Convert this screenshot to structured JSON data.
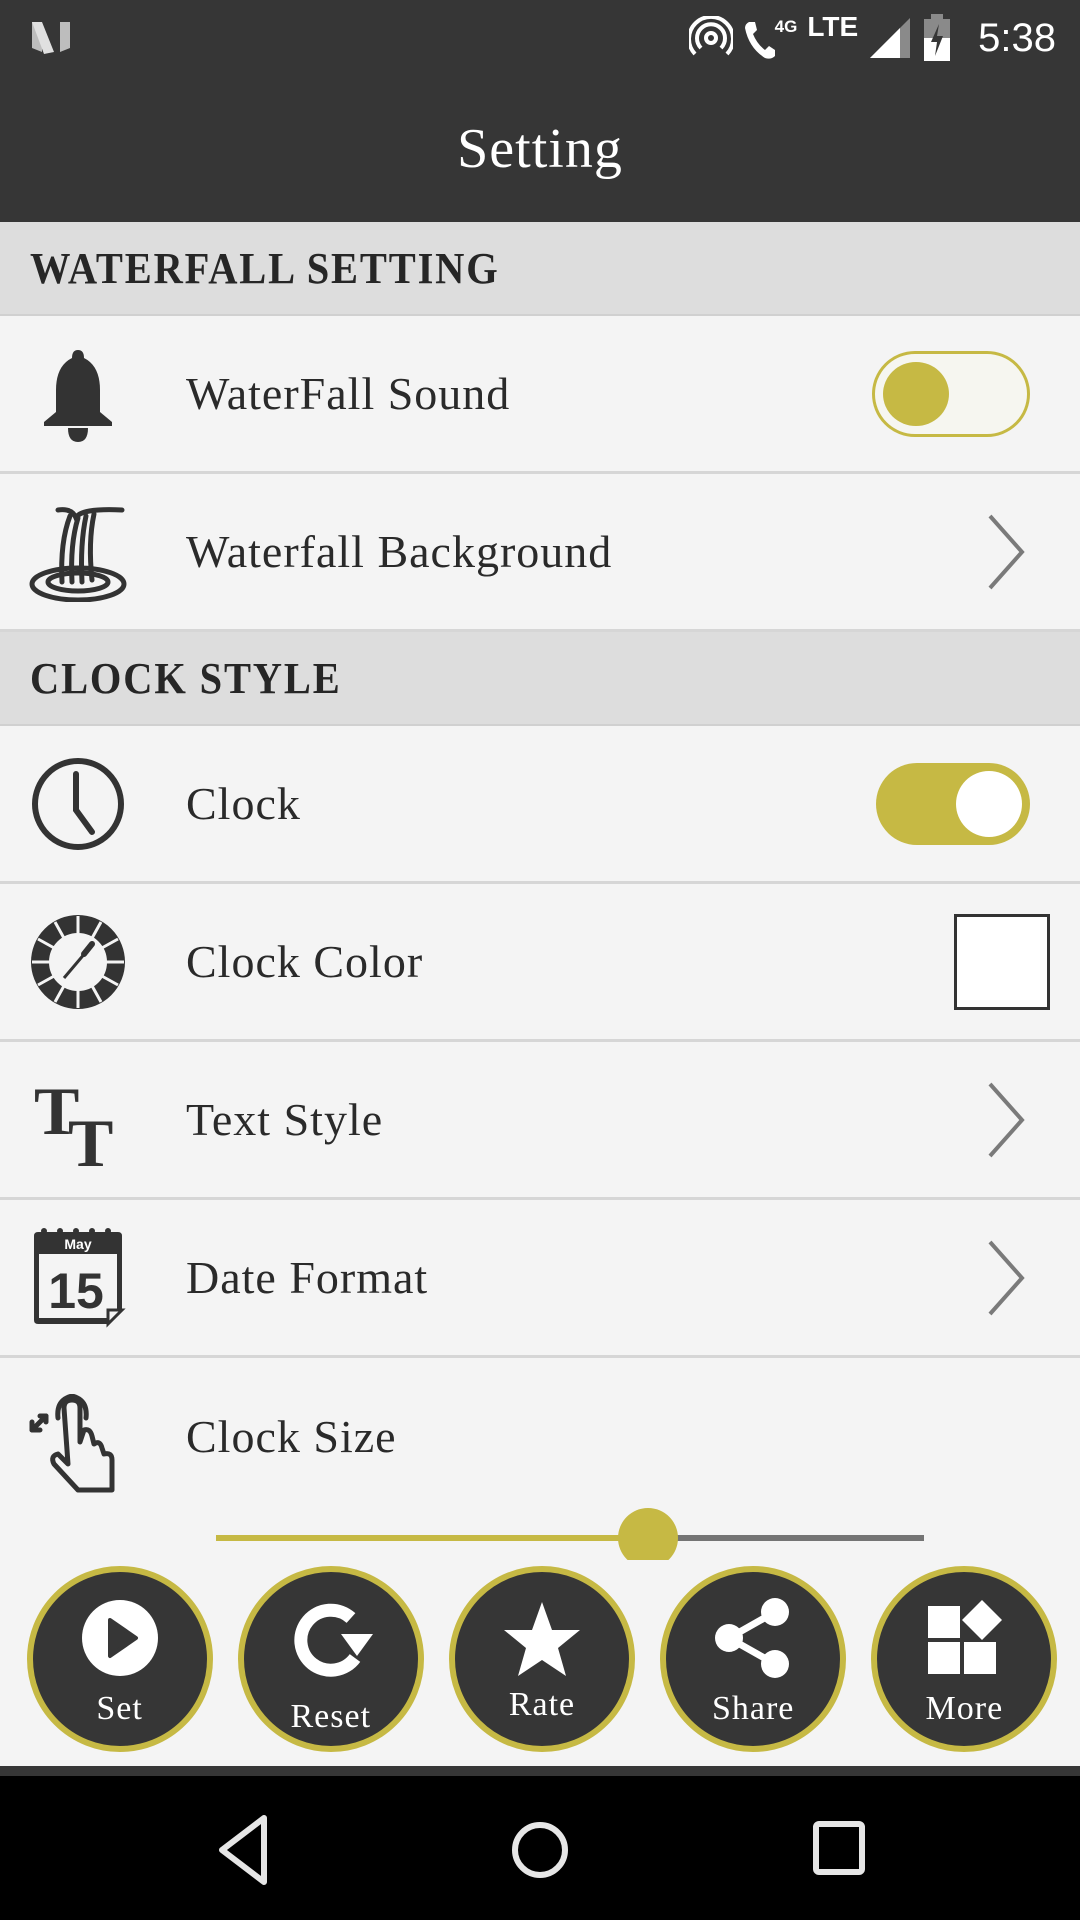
{
  "status_bar": {
    "time": "5:38",
    "network_label": "LTE",
    "call_badge": "4G",
    "icons": [
      "n-logo-icon",
      "hotspot-icon",
      "wifi-calling-icon",
      "signal-icon",
      "battery-charging-icon"
    ]
  },
  "app_bar": {
    "title": "Setting"
  },
  "sections": [
    {
      "header": "WATERFALL SETTING",
      "items": [
        {
          "label": "WaterFall Sound",
          "icon": "bell-icon",
          "control": "toggle",
          "enabled": false
        },
        {
          "label": "Waterfall Background",
          "icon": "waterfall-icon",
          "control": "chevron"
        }
      ]
    },
    {
      "header": "CLOCK STYLE",
      "items": [
        {
          "label": "Clock",
          "icon": "clock-icon",
          "control": "toggle",
          "enabled": true
        },
        {
          "label": "Clock Color",
          "icon": "color-picker-icon",
          "control": "swatch",
          "color": "#ffffff"
        },
        {
          "label": "Text Style",
          "icon": "text-style-icon",
          "control": "chevron"
        },
        {
          "label": "Date Format",
          "icon": "calendar-icon",
          "control": "chevron",
          "icon_text_month": "May",
          "icon_text_day": "15"
        },
        {
          "label": "Clock Size",
          "icon": "resize-gesture-icon",
          "control": "slider",
          "value_fraction": 0.61
        }
      ]
    }
  ],
  "actions": [
    {
      "label": "Set",
      "icon": "play-icon"
    },
    {
      "label": "Reset",
      "icon": "refresh-icon"
    },
    {
      "label": "Rate",
      "icon": "star-icon"
    },
    {
      "label": "Share",
      "icon": "share-icon"
    },
    {
      "label": "More",
      "icon": "more-apps-icon"
    }
  ],
  "nav_bar": {
    "buttons": [
      "back",
      "home",
      "recents"
    ]
  },
  "colors": {
    "accent": "#c6b944",
    "bar_dark": "#363636",
    "section_bg": "#dddddd",
    "row_bg": "#f4f4f4"
  }
}
